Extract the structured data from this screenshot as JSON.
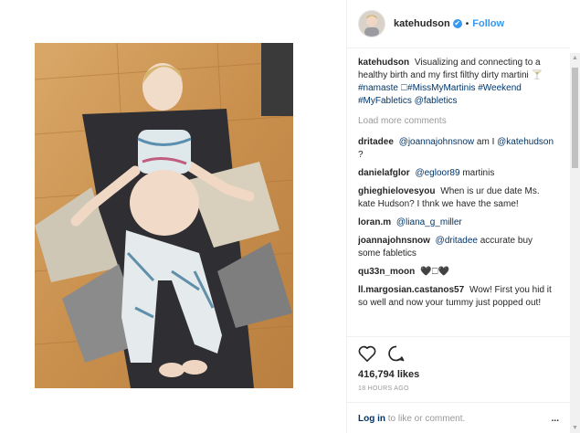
{
  "header": {
    "username": "katehudson",
    "verified_glyph": "✔",
    "separator": "•",
    "follow_label": "Follow"
  },
  "caption": {
    "username": "katehudson",
    "text": "Visualizing and connecting to a healthy birth and my first filthy dirty martini 🍸",
    "tags": "#namaste 🗆#MissMyMartinis #Weekend #MyFabletics @fabletics"
  },
  "load_more": "Load more comments",
  "comments": [
    {
      "user": "dritadee",
      "mention": "@joannajohnsnow",
      "text": "am I",
      "mention2": "@katehudson",
      "tail": "?"
    },
    {
      "user": "danielafglor",
      "mention": "@egloor89",
      "text": "martinis"
    },
    {
      "user": "ghieghielovesyou",
      "text": "When is ur due date Ms. kate Hudson? I thnk we have the same!"
    },
    {
      "user": "loran.m",
      "mention": "@liana_g_miller"
    },
    {
      "user": "joannajohnsnow",
      "mention": "@dritadee",
      "text": "accurate buy some fabletics"
    },
    {
      "user": "qu33n_moon",
      "text": "🖤🗆🖤"
    },
    {
      "user": "ll.margosian.castanos57",
      "text": "Wow! First you hid it so well and now your tummy just popped out!"
    }
  ],
  "likes": "416,794 likes",
  "timestamp": "18 HOURS AGO",
  "login": {
    "link": "Log in",
    "text": "to like or comment.",
    "more": "..."
  },
  "colors": {
    "link": "#003569",
    "follow": "#3897f0",
    "muted": "#999999"
  },
  "icons": [
    "heart-icon",
    "comment-icon",
    "more-icon",
    "verified-badge-icon"
  ]
}
